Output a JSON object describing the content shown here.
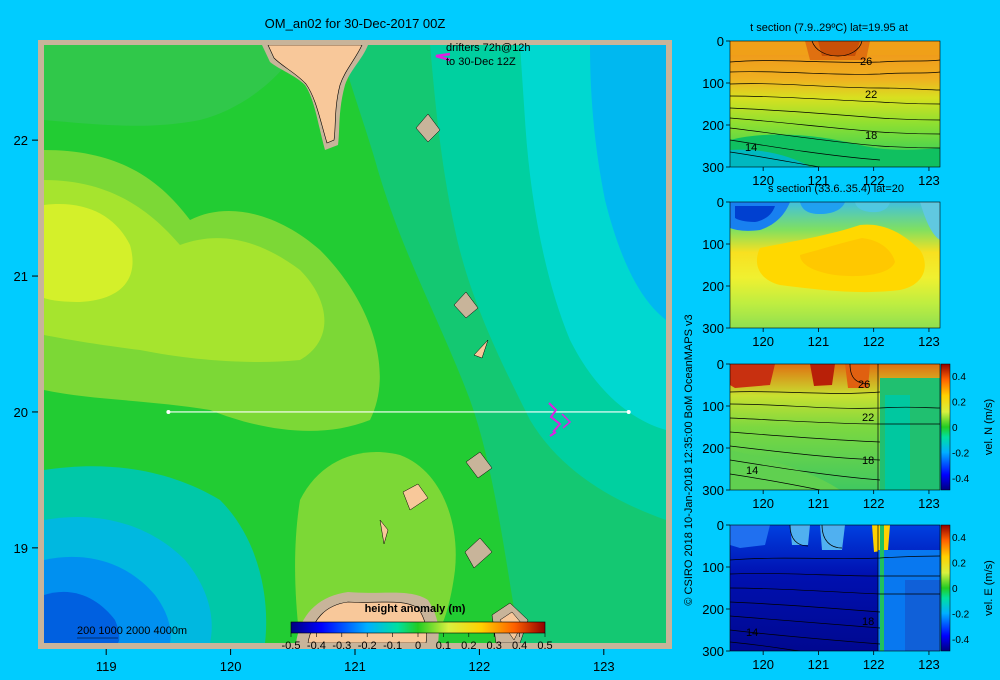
{
  "colors": {
    "background": "#00ccff",
    "frame": "#c8b49a",
    "land": "#f8c89a",
    "drifter": "#e020e0",
    "section_line": "#ffffff"
  },
  "chart_data": [
    {
      "id": "map",
      "type": "heatmap",
      "title": "OM_an02 for 30-Dec-2017 00Z",
      "xlim": [
        118.5,
        123.5
      ],
      "ylim": [
        18.3,
        22.7
      ],
      "x_ticks": [
        "119",
        "120",
        "121",
        "122",
        "123"
      ],
      "y_ticks": [
        "19",
        "20",
        "21",
        "22"
      ],
      "annotation_lines": [
        "drifters 72h@12h",
        "to 30-Dec 12Z"
      ],
      "section_line": {
        "lat": 20,
        "lon_start": 119.5,
        "lon_end": 123.2
      },
      "depth_legend": "200  1000  2000  4000m",
      "colorbar": {
        "label": "height anomaly (m)",
        "ticks": [
          "-0.5",
          "-0.4",
          "-0.3",
          "-0.2",
          "-0.1",
          "0",
          "0.1",
          "0.2",
          "0.3",
          "0.4",
          "0.5"
        ]
      }
    },
    {
      "id": "t-section",
      "type": "heatmap",
      "title": "t section (7.9..29ºC) lat=19.95 at",
      "x_ticks": [
        "120",
        "121",
        "122",
        "123"
      ],
      "y_ticks": [
        "0",
        "100",
        "200",
        "300"
      ],
      "contour_labels": [
        "26",
        "22",
        "18",
        "14"
      ]
    },
    {
      "id": "s-section",
      "type": "heatmap",
      "title": "s section (33.6..35.4) lat=20",
      "x_ticks": [
        "120",
        "121",
        "122",
        "123"
      ],
      "y_ticks": [
        "0",
        "100",
        "200",
        "300"
      ]
    },
    {
      "id": "vn-section",
      "type": "heatmap",
      "x_ticks": [
        "120",
        "121",
        "122",
        "123"
      ],
      "y_ticks": [
        "0",
        "100",
        "200",
        "300"
      ],
      "contour_labels": [
        "26",
        "22",
        "18",
        "14"
      ],
      "colorbar": {
        "label": "vel. N (m/s)",
        "ticks": [
          "0.4",
          "0.2",
          "0",
          "-0.2",
          "-0.4"
        ]
      }
    },
    {
      "id": "ve-section",
      "type": "heatmap",
      "x_ticks": [
        "120",
        "121",
        "122",
        "123"
      ],
      "y_ticks": [
        "0",
        "100",
        "200",
        "300"
      ],
      "contour_labels": [
        "18",
        "14"
      ],
      "colorbar": {
        "label": "vel. E (m/s)",
        "ticks": [
          "0.4",
          "0.2",
          "0",
          "-0.2",
          "-0.4"
        ]
      }
    }
  ],
  "credit": "© CSIRO 2018   10-Jan-2018 12:35:00 BoM OceanMAPS v3"
}
